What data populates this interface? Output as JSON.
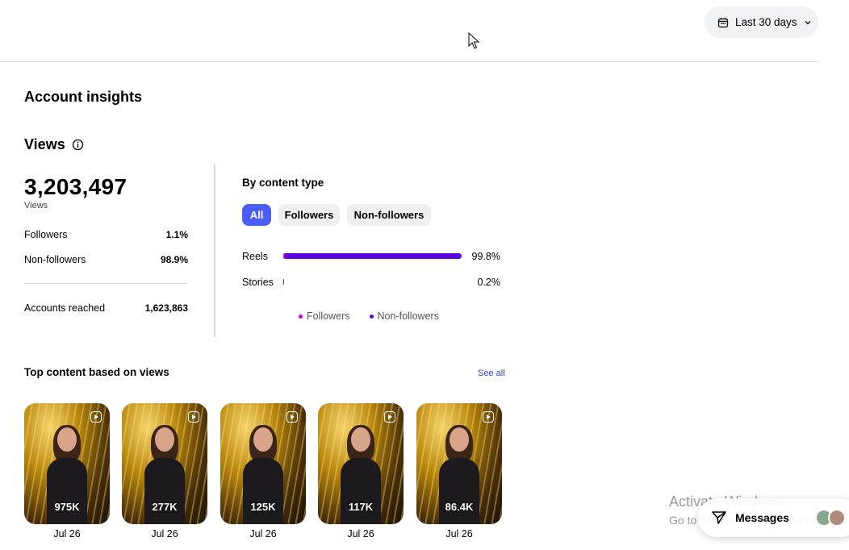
{
  "header": {
    "date_range": "Last 30 days"
  },
  "page_title": "Account insights",
  "views": {
    "title": "Views",
    "total": "3,203,497",
    "total_label": "Views",
    "stats": [
      {
        "label": "Followers",
        "value": "1.1%"
      },
      {
        "label": "Non-followers",
        "value": "98.9%"
      }
    ],
    "accounts_reached": {
      "label": "Accounts reached",
      "value": "1,623,863"
    }
  },
  "by_content_type": {
    "title": "By content type",
    "filters": [
      "All",
      "Followers",
      "Non-followers"
    ],
    "active_filter": "All",
    "rows": [
      {
        "label": "Reels",
        "percent": "99.8%",
        "value": 99.8
      },
      {
        "label": "Stories",
        "percent": "0.2%",
        "value": 0.2
      }
    ],
    "legend": [
      {
        "label": "Followers",
        "color": "#d300c5"
      },
      {
        "label": "Non-followers",
        "color": "#5a06dc"
      }
    ]
  },
  "top_content": {
    "title": "Top content based on views",
    "see_all": "See all",
    "items": [
      {
        "views": "975K",
        "date": "Jul 26"
      },
      {
        "views": "277K",
        "date": "Jul 26"
      },
      {
        "views": "125K",
        "date": "Jul 26"
      },
      {
        "views": "117K",
        "date": "Jul 26"
      },
      {
        "views": "86.4K",
        "date": "Jul 26"
      }
    ]
  },
  "messages": {
    "label": "Messages"
  },
  "watermark": {
    "line1": "Activate Windows",
    "line2": "Go to Settings to activate Windows."
  },
  "colors": {
    "accent": "#4a5df9",
    "followers": "#d300c5",
    "non_followers": "#5a06dc",
    "link": "#2c3ec0"
  }
}
